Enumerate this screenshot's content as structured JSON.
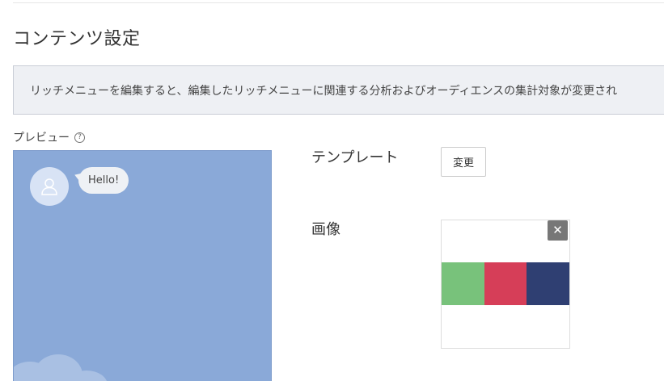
{
  "page": {
    "title": "コンテンツ設定"
  },
  "notice": {
    "text": "リッチメニューを編集すると、編集したリッチメニューに関連する分析およびオーディエンスの集計対象が変更され"
  },
  "preview": {
    "label": "プレビュー",
    "help_icon_glyph": "?",
    "bubble_text": "Hello!",
    "background_color": "#8aa9d8"
  },
  "template": {
    "label": "テンプレート",
    "change_button": "変更"
  },
  "image": {
    "label": "画像",
    "remove_glyph": "✕",
    "swatch_colors": [
      "#78c27b",
      "#d63e58",
      "#2f3f72"
    ]
  }
}
